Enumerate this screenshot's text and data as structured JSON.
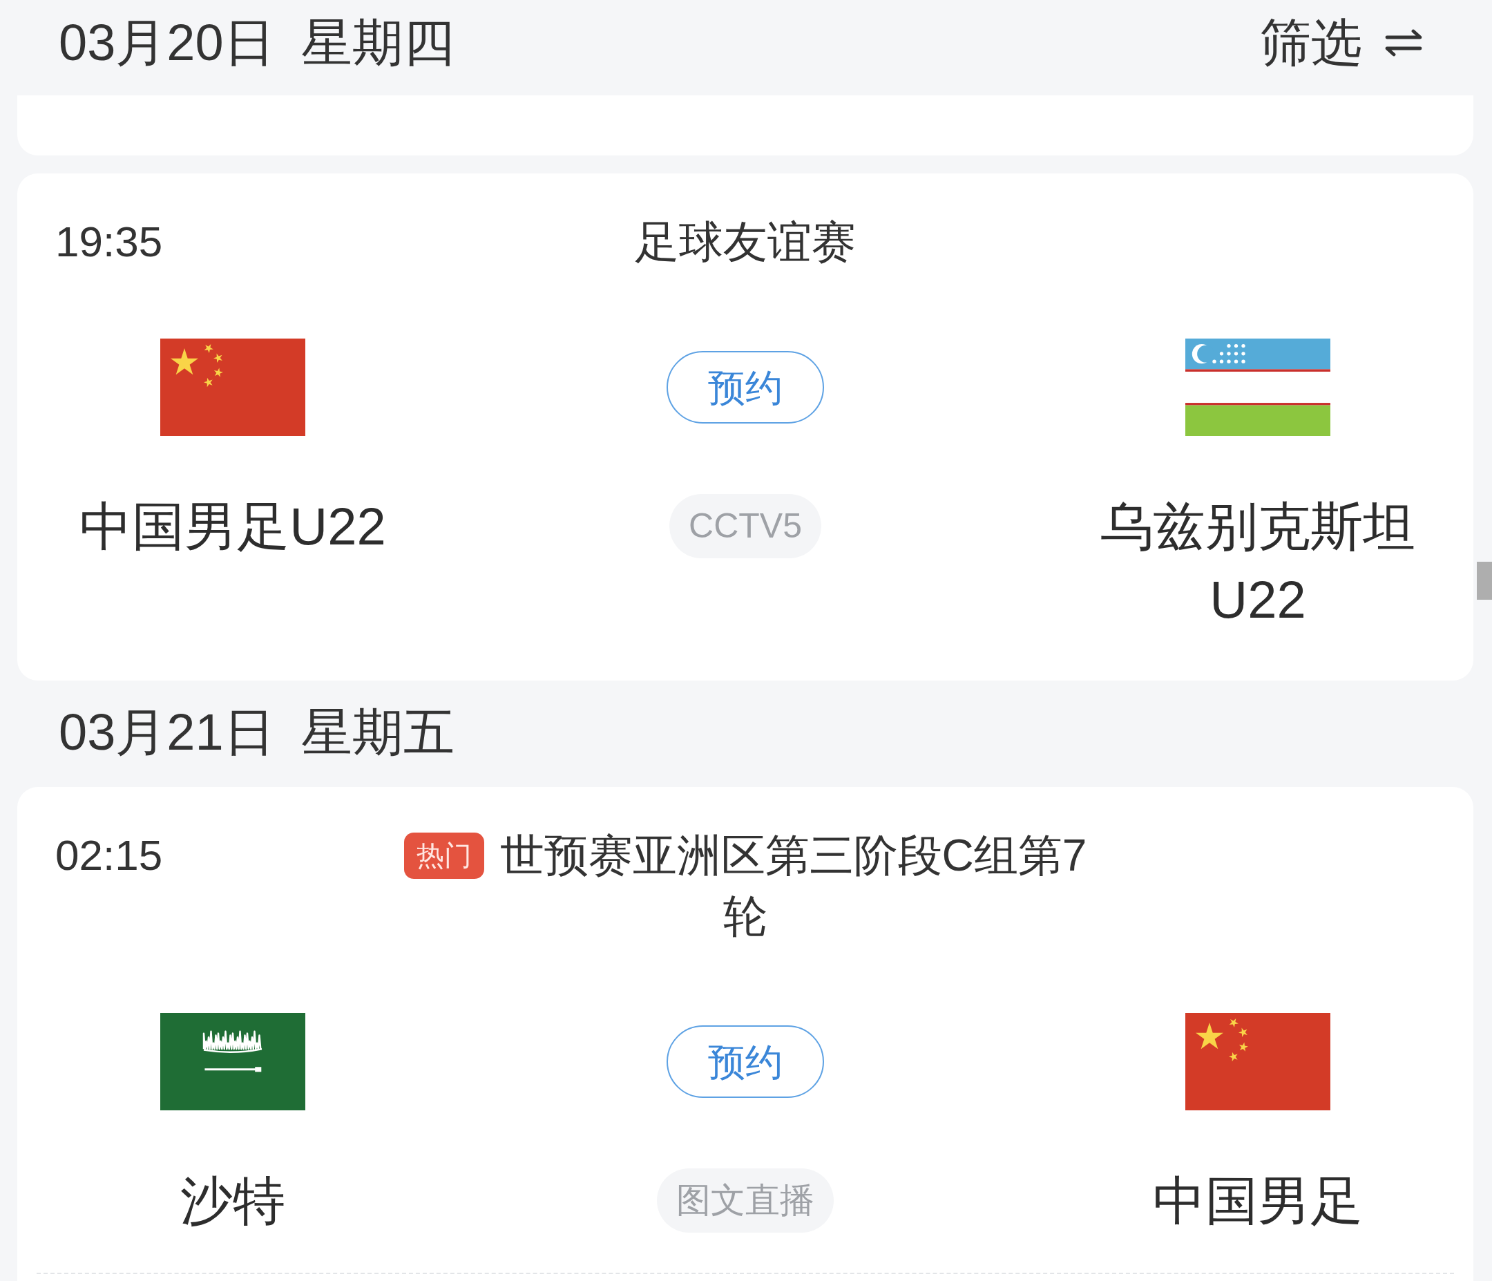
{
  "days": [
    {
      "date": "03月20日",
      "weekday": "星期四",
      "filter": "筛选",
      "matches": [
        {
          "time": "19:35",
          "competition": "足球友谊赛",
          "home": {
            "name": "中国男足U22",
            "kind": "china"
          },
          "action": "预约",
          "channel": "CCTV5",
          "away": {
            "name": "乌兹别克斯坦U22",
            "kind": "uzbekistan"
          }
        }
      ]
    },
    {
      "date": "03月21日",
      "weekday": "星期五",
      "matches": [
        {
          "time": "02:15",
          "badge": "热门",
          "competition": "世预赛亚洲区第三阶段C组第7轮",
          "home": {
            "name": "沙特",
            "kind": "saudi"
          },
          "action": "预约",
          "channel": "图文直播",
          "away": {
            "name": "中国男足",
            "kind": "china"
          }
        }
      ]
    }
  ]
}
